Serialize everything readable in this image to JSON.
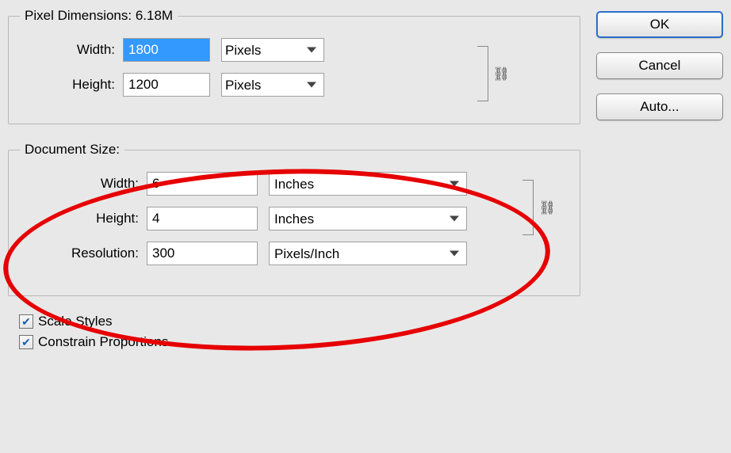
{
  "pixelDimensions": {
    "legend": "Pixel Dimensions:  6.18M",
    "widthLabel": "Width:",
    "widthValue": "1800",
    "widthUnit": "Pixels",
    "heightLabel": "Height:",
    "heightValue": "1200",
    "heightUnit": "Pixels"
  },
  "documentSize": {
    "legend": "Document Size:",
    "widthLabel": "Width:",
    "widthValue": "6",
    "widthUnit": "Inches",
    "heightLabel": "Height:",
    "heightValue": "4",
    "heightUnit": "Inches",
    "resolutionLabel": "Resolution:",
    "resolutionValue": "300",
    "resolutionUnit": "Pixels/Inch"
  },
  "checkboxes": {
    "scaleStyles": "Scale Styles",
    "constrainProportions": "Constrain Proportions"
  },
  "buttons": {
    "ok": "OK",
    "cancel": "Cancel",
    "auto": "Auto..."
  },
  "linkGlyph": "⛓"
}
